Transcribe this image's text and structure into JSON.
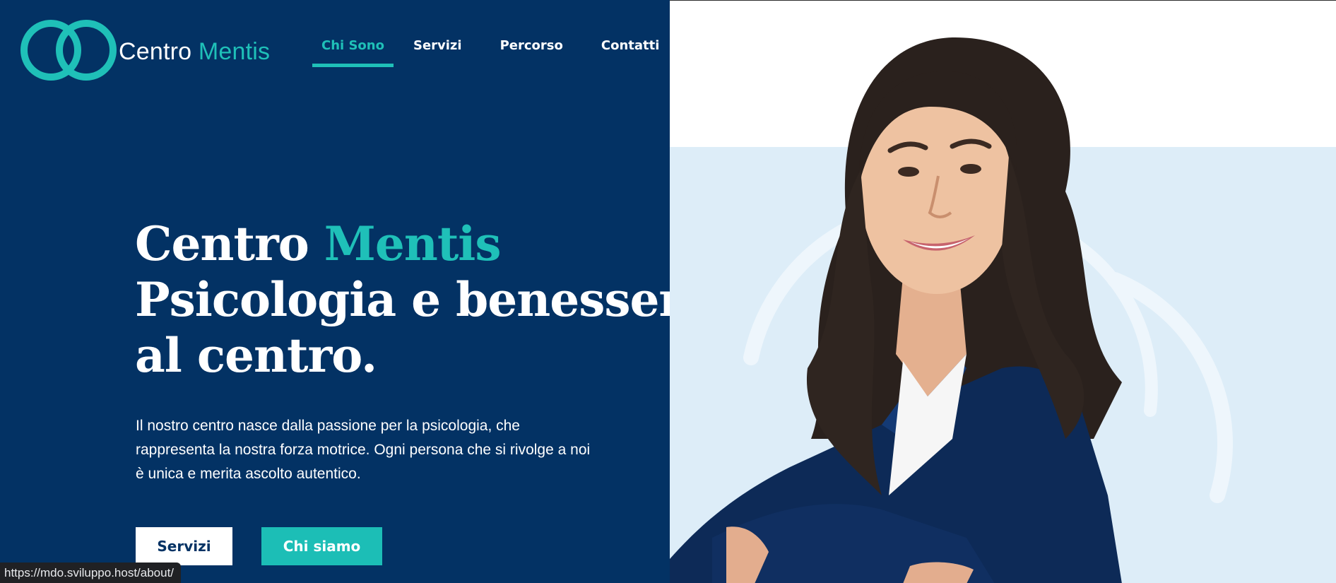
{
  "brand": {
    "name_primary": "Centro",
    "name_accent": "Mentis",
    "logo_icon": "interlocked-rings-icon"
  },
  "nav": {
    "items": [
      {
        "label": "Chi Sono",
        "active": true
      },
      {
        "label": "Servizi",
        "active": false
      },
      {
        "label": "Percorso",
        "active": false
      },
      {
        "label": "Contatti",
        "active": false
      }
    ]
  },
  "hero": {
    "title_line1_primary": "Centro",
    "title_line1_accent": "Mentis",
    "title_line2": "Psicologia e benessere",
    "title_line3": "al centro.",
    "description": "Il nostro centro nasce dalla passione per la psicologia, che rappresenta la nostra forza motrice. Ogni persona che si rivolge a noi è unica e merita ascolto autentico.",
    "buttons": {
      "primary_label": "Servizi",
      "secondary_label": "Chi siamo"
    }
  },
  "status_bar": {
    "url": "https://mdo.sviluppo.host/about/"
  },
  "colors": {
    "navy": "#033264",
    "teal": "#1fc0b8",
    "light_blue": "#ddedf8",
    "white": "#ffffff"
  }
}
